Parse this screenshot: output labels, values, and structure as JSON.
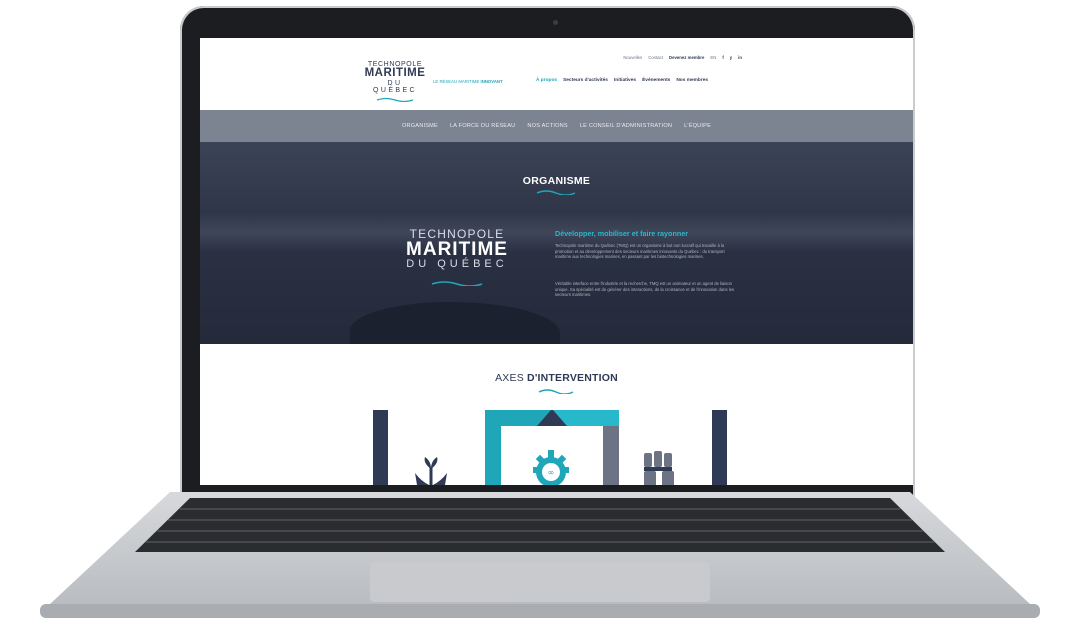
{
  "header": {
    "logo": {
      "line1": "TECHNOPOLE",
      "line2": "MARITIME",
      "line3": "DU QUÉBEC"
    },
    "tagline_prefix": "LE RÉSEAU MARITIME",
    "tagline_emphasis": "INNOVANT",
    "utility_nav": [
      {
        "label": "Nouvelles"
      },
      {
        "label": "Contact"
      },
      {
        "label": "Devenez membre"
      },
      {
        "label": "EN"
      }
    ],
    "social": [
      "f",
      "y",
      "in"
    ],
    "main_nav": [
      {
        "label": "À propos",
        "active": true
      },
      {
        "label": "Secteurs d'activités"
      },
      {
        "label": "Initiatives"
      },
      {
        "label": "Événements"
      },
      {
        "label": "Nos membres"
      }
    ]
  },
  "sub_nav": [
    "ORGANISME",
    "LA FORCE DU RÉSEAU",
    "NOS ACTIONS",
    "LE CONSEIL D'ADMINISTRATION",
    "L'ÉQUIPE"
  ],
  "hero": {
    "title": "ORGANISME",
    "logo": {
      "line1": "TECHNOPOLE",
      "line2": "MARITIME",
      "line3": "DU QUÉBEC"
    },
    "heading": "Développer, mobiliser et faire rayonner",
    "paragraph1": "Technopole maritime du Québec (TMQ) est un organisme à but non lucratif qui travaille à la promotion et au développement des secteurs maritimes innovants du Québec : du transport maritime aux technologies marines, en passant par les biotechnologies marines.",
    "paragraph2": "Véritable interface entre l'industrie et la recherche, TMQ est un animateur et un agent de liaison unique. Sa spécialité est de générer des interactions, de la croissance et de l'innovation dans les secteurs maritimes."
  },
  "axes": {
    "title_prefix": "AXES",
    "title_emphasis": "D'INTERVENTION"
  },
  "colors": {
    "accent": "#1fa6b9",
    "navy": "#2f3a55",
    "subnav": "#7c8391",
    "hero_bg": "#2b3244"
  }
}
